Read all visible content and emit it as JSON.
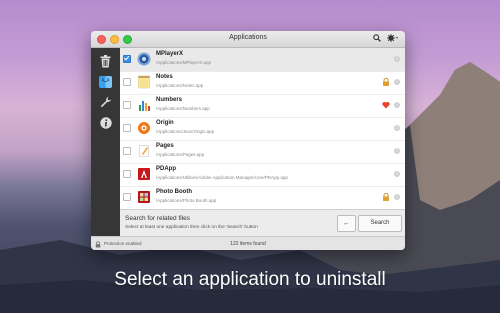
{
  "window": {
    "title": "Applications",
    "search_icon": "search-icon",
    "settings_icon": "gear-icon"
  },
  "sidebar": {
    "items": [
      {
        "icon": "trash-icon"
      },
      {
        "icon": "finder-icon"
      },
      {
        "icon": "wrench-icon"
      },
      {
        "icon": "info-icon"
      }
    ]
  },
  "apps": [
    {
      "name": "MPlayerX",
      "path": "/Applications/MPlayerX.app",
      "checked": true,
      "icon": "mplayerx-icon",
      "flag": ""
    },
    {
      "name": "Notes",
      "path": "/Applications/Notes.app",
      "checked": false,
      "icon": "notes-icon",
      "flag": "lock-icon"
    },
    {
      "name": "Numbers",
      "path": "/Applications/Numbers.app",
      "checked": false,
      "icon": "numbers-icon",
      "flag": "heart-icon"
    },
    {
      "name": "Origin",
      "path": "/Applications/Jeux/Origin.app",
      "checked": false,
      "icon": "origin-icon",
      "flag": ""
    },
    {
      "name": "Pages",
      "path": "/Applications/Pages.app",
      "checked": false,
      "icon": "pages-icon",
      "flag": ""
    },
    {
      "name": "PDApp",
      "path": "/Applications/Utilities/Adobe Application Manager/core/PDApp.app",
      "checked": false,
      "icon": "pdapp-icon",
      "flag": ""
    },
    {
      "name": "Photo Booth",
      "path": "/Applications/Photo Booth.app",
      "checked": false,
      "icon": "photobooth-icon",
      "flag": "lock-icon"
    }
  ],
  "hint": {
    "title": "Search for related files",
    "subtitle": "Select at least one application then click on the 'Search' button"
  },
  "buttons": {
    "back_label": "←",
    "search_label": "Search"
  },
  "status": {
    "protection": "Protection enabled",
    "count": "122 items found"
  },
  "caption": "Select an application to uninstall",
  "colors": {
    "sidebar": "#363636",
    "checkbox_on": "#3b8ee8",
    "heart": "#e8452b",
    "lock": "#e0a030"
  }
}
